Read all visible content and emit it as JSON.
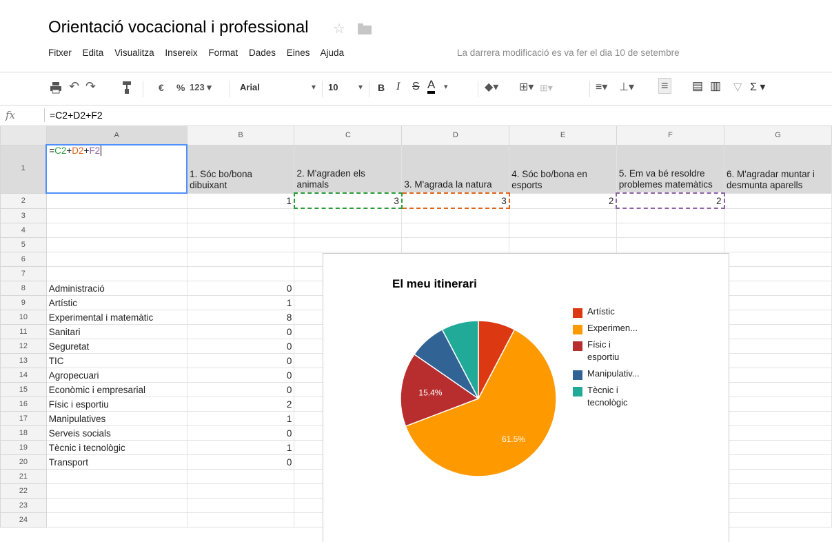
{
  "doc": {
    "title": "Orientació vocacional i professional"
  },
  "menu": [
    "Fitxer",
    "Edita",
    "Visualitza",
    "Insereix",
    "Format",
    "Dades",
    "Eines",
    "Ajuda"
  ],
  "last_modified": "La darrera modificació es va fer el dia 10 de setembre",
  "toolbar": {
    "currency": "€",
    "percent": "%",
    "number_format": "123 ▾",
    "font": "Arial",
    "font_size": "10",
    "bold": "B",
    "italic": "I",
    "strike": "S",
    "text_color": "A"
  },
  "formula_bar": {
    "fx": "fx",
    "value": "=C2+D2+F2"
  },
  "columns": [
    "A",
    "B",
    "C",
    "D",
    "E",
    "F",
    "G"
  ],
  "header_row": [
    "1. Sóc bo/bona dibuixant",
    "2. M'agraden els animals",
    "3. M'agrada la natura",
    "4. Sóc bo/bona en esports",
    "5. Em va bé resoldre problemes matemàtics",
    "6. M'agradar muntar i desmunta aparells"
  ],
  "row2": [
    "1",
    "3",
    "3",
    "2",
    "2"
  ],
  "a1_formula": {
    "eq": "=",
    "c": "C2",
    "p1": "+",
    "d": "D2",
    "p2": "+",
    "f": "F2"
  },
  "categories": [
    {
      "label": "Administració",
      "value": "0"
    },
    {
      "label": "Artístic",
      "value": "1"
    },
    {
      "label": "Experimental i matemàtic",
      "value": "8"
    },
    {
      "label": "Sanitari",
      "value": "0"
    },
    {
      "label": "Seguretat",
      "value": "0"
    },
    {
      "label": "TIC",
      "value": "0"
    },
    {
      "label": "Agropecuari",
      "value": "0"
    },
    {
      "label": "Econòmic i empresarial",
      "value": "0"
    },
    {
      "label": "Físic i esportiu",
      "value": "2"
    },
    {
      "label": "Manipulatives",
      "value": "1"
    },
    {
      "label": "Serveis socials",
      "value": "0"
    },
    {
      "label": "Tècnic i tecnològic",
      "value": "1"
    },
    {
      "label": "Transport",
      "value": "0"
    }
  ],
  "chart_data": {
    "type": "pie",
    "title": "El meu itinerari",
    "legend_position": "right",
    "slices": [
      {
        "name": "Artístic",
        "legend": [
          "Artístic"
        ],
        "value": 1,
        "color": "#dc3912",
        "label": ""
      },
      {
        "name": "Experimental i matemàtic",
        "legend": [
          "Experimen..."
        ],
        "value": 8,
        "color": "#ff9900",
        "label": "61.5%"
      },
      {
        "name": "Físic i esportiu",
        "legend": [
          "Físic i",
          "esportiu"
        ],
        "value": 2,
        "color": "#b82e2e",
        "label": "15.4%"
      },
      {
        "name": "Manipulatives",
        "legend": [
          "Manipulativ..."
        ],
        "value": 1,
        "color": "#316395",
        "label": ""
      },
      {
        "name": "Tècnic i tecnològic",
        "legend": [
          "Tècnic i",
          "tecnològic"
        ],
        "value": 1,
        "color": "#22aa99",
        "label": ""
      }
    ]
  }
}
